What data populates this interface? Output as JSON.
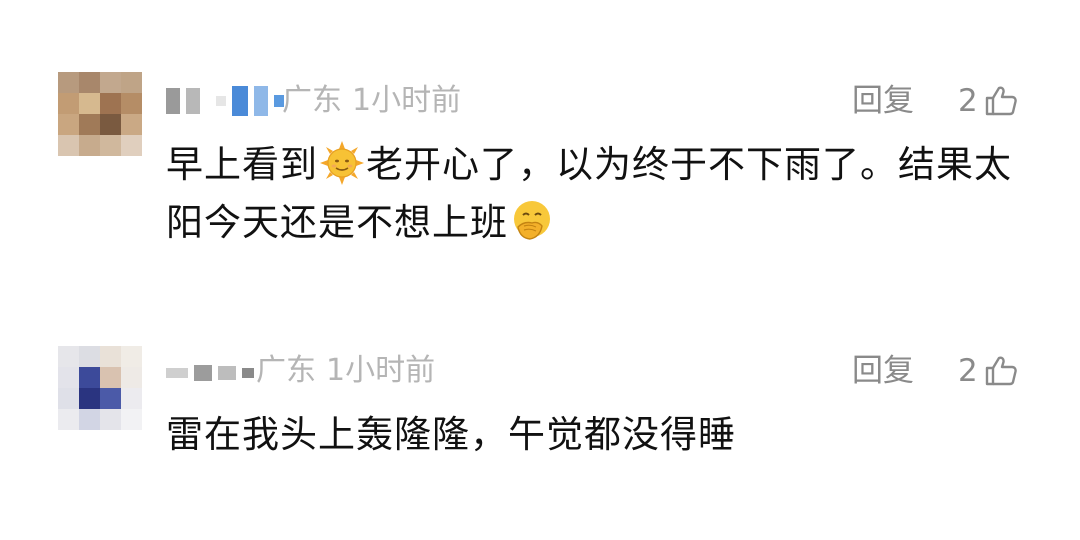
{
  "comments": [
    {
      "location": "广东",
      "time": "1小时前",
      "reply_label": "回复",
      "like_count": "2",
      "text_part1": "早上看到",
      "emoji1": "sun-with-face-icon",
      "text_part2": "老开心了，以为终于不下雨了。结果太阳今天还是不想上班",
      "emoji2": "face-with-hand-over-mouth-icon"
    },
    {
      "location": "广东",
      "time": "1小时前",
      "reply_label": "回复",
      "like_count": "2",
      "text_part1": "雷在我头上轰隆隆，午觉都没得睡"
    }
  ],
  "colors": {
    "meta": "#b5b5b5",
    "action": "#8a8a8a",
    "text": "#111111"
  }
}
